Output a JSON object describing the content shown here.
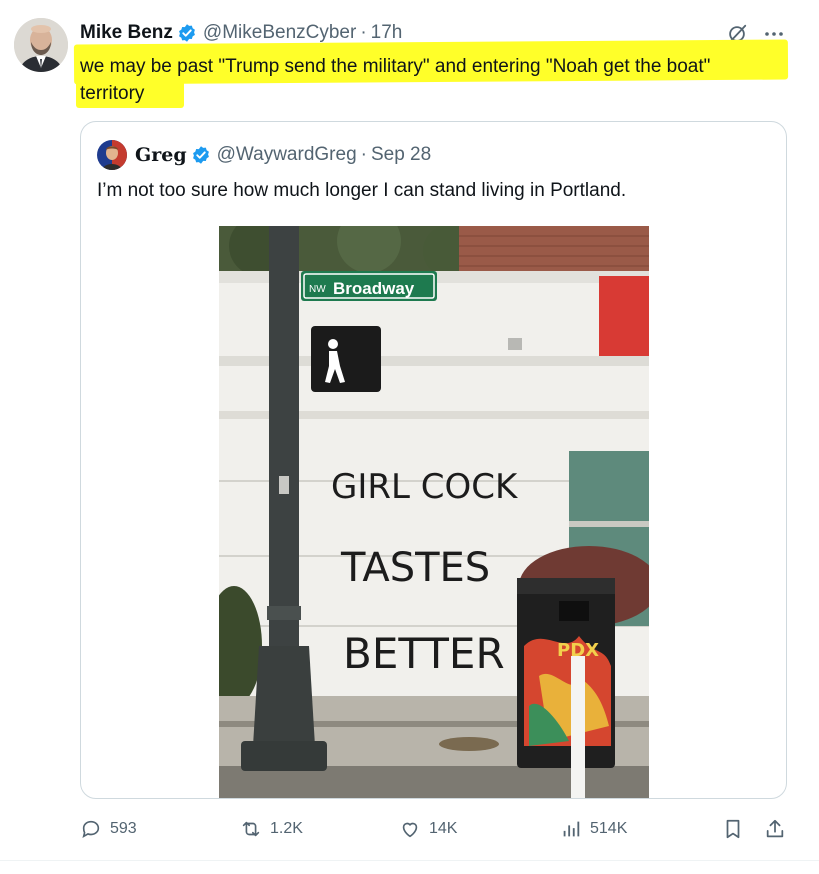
{
  "tweet": {
    "author_name": "Mike Benz",
    "author_handle": "@MikeBenzCyber",
    "separator": "·",
    "time": "17h",
    "text_line1": "we may be past \"Trump send the military\" and entering \"Noah get the boat\"",
    "text_line2": "territory",
    "highlight_color": "#ffff29"
  },
  "quote": {
    "author_name": "Greg",
    "author_handle": "@WaywardGreg",
    "separator": "·",
    "date": "Sep 28",
    "text": "I’m not too sure how much longer I can stand living in Portland.",
    "image": {
      "street_sign_prefix": "NW",
      "street_sign_name": "Broadway",
      "graffiti_line1": "GIRL COCK",
      "graffiti_line2": "TASTES",
      "graffiti_line3": "BETTER",
      "bin_tag": "PDX"
    }
  },
  "actions": {
    "replies": "593",
    "reposts": "1.2K",
    "likes": "14K",
    "views": "514K"
  },
  "colors": {
    "verified": "#1d9bf0",
    "secondary_text": "#536471",
    "border": "#cfd9de"
  },
  "icons": [
    "verified-badge-icon",
    "grok-icon",
    "more-icon",
    "reply-icon",
    "repost-icon",
    "like-icon",
    "views-icon",
    "bookmark-icon",
    "share-icon"
  ]
}
